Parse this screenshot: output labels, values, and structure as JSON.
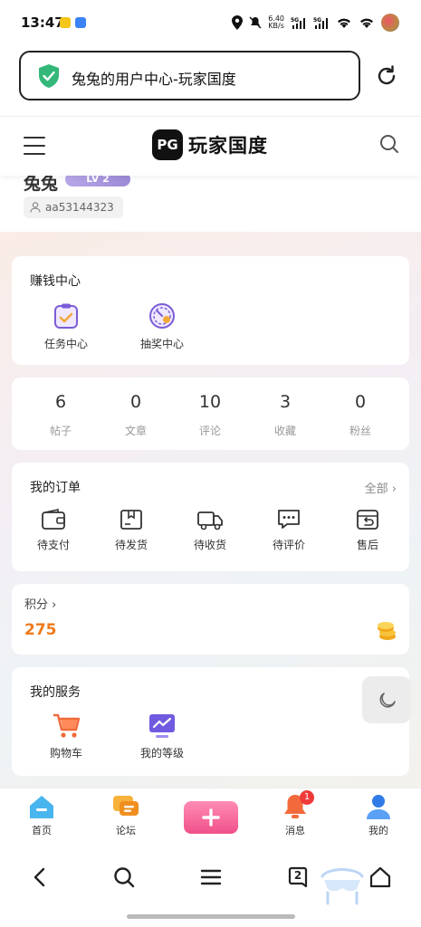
{
  "status_bar": {
    "time": "13:47",
    "net_speed_value": "6.40",
    "net_speed_unit": "KB/s",
    "signal_1": "5G",
    "signal_2": "5G"
  },
  "url_bar": {
    "title": "兔兔的用户中心-玩家国度"
  },
  "header": {
    "logo_mark": "PG",
    "logo_text": "玩家国度"
  },
  "profile": {
    "nickname": "兔兔",
    "level": "LV 2",
    "user_id": "aa53144323"
  },
  "earn_center": {
    "title": "赚钱中心",
    "items": [
      {
        "label": "任务中心",
        "icon": "task-clipboard-icon"
      },
      {
        "label": "抽奖中心",
        "icon": "lottery-dial-icon"
      }
    ]
  },
  "stats": [
    {
      "value": "6",
      "label": "帖子"
    },
    {
      "value": "0",
      "label": "文章"
    },
    {
      "value": "10",
      "label": "评论"
    },
    {
      "value": "3",
      "label": "收藏"
    },
    {
      "value": "0",
      "label": "粉丝"
    }
  ],
  "orders": {
    "title": "我的订单",
    "all_label": "全部",
    "items": [
      {
        "label": "待支付",
        "icon": "wallet-icon"
      },
      {
        "label": "待发货",
        "icon": "package-icon"
      },
      {
        "label": "待收货",
        "icon": "truck-icon"
      },
      {
        "label": "待评价",
        "icon": "comment-icon"
      },
      {
        "label": "售后",
        "icon": "return-icon"
      }
    ]
  },
  "points": {
    "label": "积分",
    "value": "275"
  },
  "services": {
    "title": "我的服务",
    "items": [
      {
        "label": "购物车",
        "icon": "cart-icon"
      },
      {
        "label": "我的等级",
        "icon": "level-chart-icon"
      }
    ]
  },
  "tabbar": {
    "items": [
      {
        "label": "首页",
        "icon": "home-icon"
      },
      {
        "label": "论坛",
        "icon": "forum-icon"
      },
      {
        "label": "",
        "icon": "plus-icon"
      },
      {
        "label": "消息",
        "icon": "bell-icon"
      },
      {
        "label": "我的",
        "icon": "user-icon"
      }
    ],
    "message_badge": "1"
  },
  "browser_nav": {
    "tabs_count": "2"
  },
  "colors": {
    "accent_orange": "#ef7a1a",
    "plus_pink": "#f0508a",
    "badge_red": "#f03a3a",
    "purple_icon": "#7b5cd6"
  }
}
